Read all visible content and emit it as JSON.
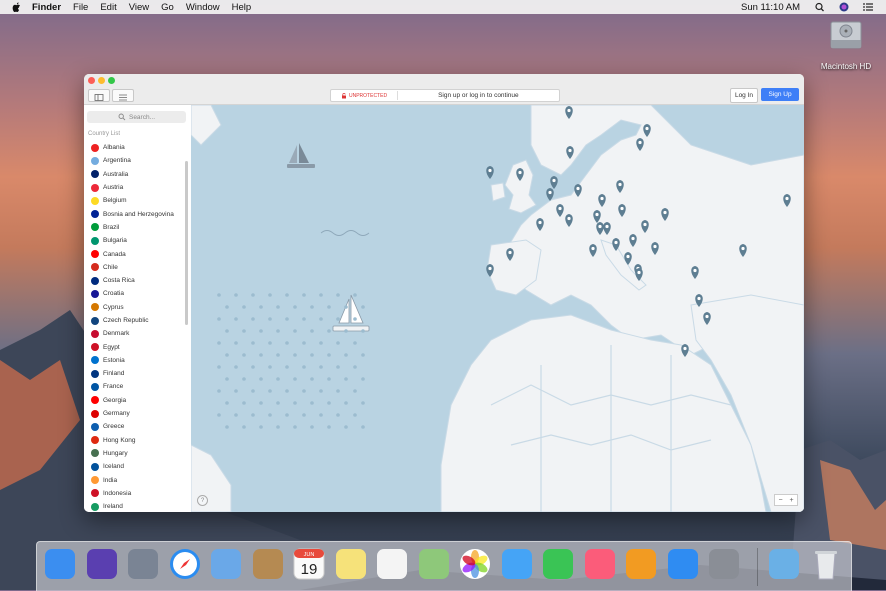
{
  "menubar": {
    "app": "Finder",
    "items": [
      "File",
      "Edit",
      "View",
      "Go",
      "Window",
      "Help"
    ],
    "clock": "Sun 11:10 AM"
  },
  "desktop": {
    "drive_label": "Macintosh HD"
  },
  "app_window": {
    "status": "UNPROTECTED",
    "banner": "Sign up or log in to continue",
    "login_label": "Log In",
    "signup_label": "Sign Up",
    "search_placeholder": "Search...",
    "list_title": "Country List",
    "countries": [
      {
        "name": "Albania",
        "color": "#e22"
      },
      {
        "name": "Argentina",
        "color": "#74acdf"
      },
      {
        "name": "Australia",
        "color": "#012169"
      },
      {
        "name": "Austria",
        "color": "#ed2939"
      },
      {
        "name": "Belgium",
        "color": "#fdda24"
      },
      {
        "name": "Bosnia and Herzegovina",
        "color": "#002395"
      },
      {
        "name": "Brazil",
        "color": "#009c3b"
      },
      {
        "name": "Bulgaria",
        "color": "#00966e"
      },
      {
        "name": "Canada",
        "color": "#ff0000"
      },
      {
        "name": "Chile",
        "color": "#d52b1e"
      },
      {
        "name": "Costa Rica",
        "color": "#002b7f"
      },
      {
        "name": "Croatia",
        "color": "#171796"
      },
      {
        "name": "Cyprus",
        "color": "#d57800"
      },
      {
        "name": "Czech Republic",
        "color": "#11457e"
      },
      {
        "name": "Denmark",
        "color": "#c60c30"
      },
      {
        "name": "Egypt",
        "color": "#ce1126"
      },
      {
        "name": "Estonia",
        "color": "#0072ce"
      },
      {
        "name": "Finland",
        "color": "#003580"
      },
      {
        "name": "France",
        "color": "#0055a4"
      },
      {
        "name": "Georgia",
        "color": "#ff0000"
      },
      {
        "name": "Germany",
        "color": "#dd0000"
      },
      {
        "name": "Greece",
        "color": "#0d5eaf"
      },
      {
        "name": "Hong Kong",
        "color": "#de2910"
      },
      {
        "name": "Hungary",
        "color": "#477050"
      },
      {
        "name": "Iceland",
        "color": "#02529c"
      },
      {
        "name": "India",
        "color": "#ff9933"
      },
      {
        "name": "Indonesia",
        "color": "#ce1126"
      },
      {
        "name": "Ireland",
        "color": "#169b62"
      }
    ],
    "zoom_minus": "−",
    "zoom_plus": "+",
    "help": "?"
  },
  "dock": {
    "items": [
      "finder-icon",
      "siri-icon",
      "launchpad-icon",
      "safari-icon",
      "mail-icon",
      "contacts-icon",
      "calendar-icon",
      "notes-icon",
      "reminders-icon",
      "maps-icon",
      "photos-icon",
      "messages-icon",
      "facetime-icon",
      "itunes-icon",
      "ibooks-icon",
      "app-store-icon",
      "system-preferences-icon",
      "downloads-icon",
      "trash-icon"
    ],
    "calendar_month": "JUN",
    "calendar_day": "19"
  }
}
